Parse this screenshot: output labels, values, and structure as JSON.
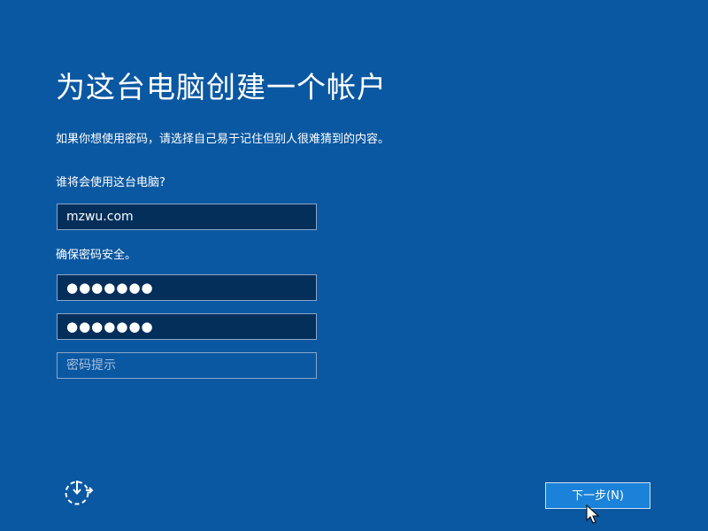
{
  "page": {
    "title": "为这台电脑创建一个帐户",
    "subtitle": "如果你想使用密码，请选择自己易于记住但别人很难猜到的内容。"
  },
  "form": {
    "username_label": "谁将会使用这台电脑?",
    "username_value": "mzwu.com",
    "security_label": "确保密码安全。",
    "password_value": "●●●●●●●",
    "confirm_password_value": "●●●●●●●",
    "hint_placeholder": "密码提示"
  },
  "footer": {
    "accessibility_icon": "ease-of-access-icon",
    "next_label": "下一步(N)"
  },
  "colors": {
    "background": "#0b58a2",
    "field_background": "#042f5b",
    "button_background": "#1a82d8"
  }
}
